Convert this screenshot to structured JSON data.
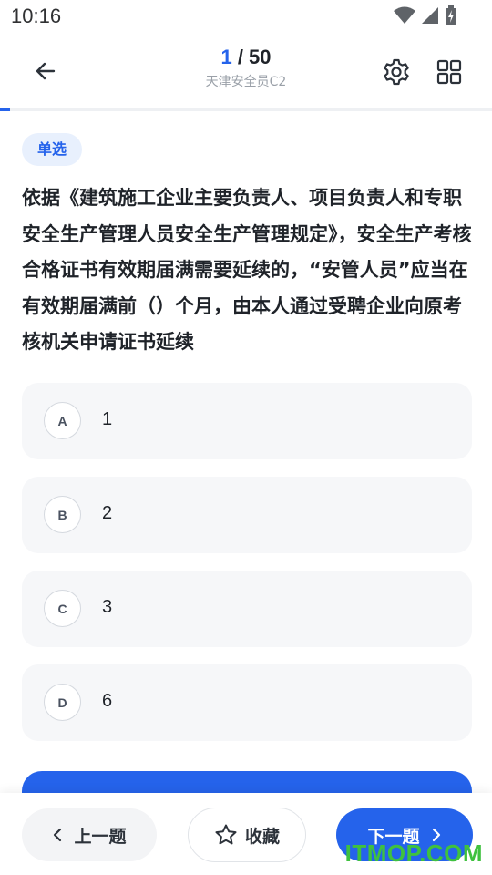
{
  "status_bar": {
    "time": "10:16",
    "icons": [
      "wifi-icon",
      "signal-icon",
      "battery-charging-icon"
    ]
  },
  "header": {
    "current": "1",
    "separator": " / ",
    "total": "50",
    "subtitle": "天津安全员C2",
    "icons": [
      "back-arrow-icon",
      "gear-icon",
      "grid-icon"
    ]
  },
  "progress": {
    "fraction": 0.02
  },
  "question": {
    "type": "单选",
    "text": "依据《建筑施工企业主要负责人、项目负责人和专职安全生产管理人员安全生产管理规定》，安全生产考核合格证书有效期届满需要延续的，“安管人员”应当在有效期届满前（）个月，由本人通过受聘企业向原考核机关申请证书延续",
    "options": [
      {
        "letter": "A",
        "text": "1"
      },
      {
        "letter": "B",
        "text": "2"
      },
      {
        "letter": "C",
        "text": "3"
      },
      {
        "letter": "D",
        "text": "6"
      }
    ]
  },
  "bottom_bar": {
    "prev_label": "上一题",
    "favorite_label": "收藏",
    "next_label": "下一题",
    "icons": [
      "chevron-left-icon",
      "star-icon",
      "chevron-right-icon"
    ]
  },
  "watermark": "ITMOP.COM",
  "colors": {
    "accent": "#2563eb",
    "badge_bg": "#e8f0fd",
    "option_bg": "#f6f7f9",
    "watermark": "#3fc13f"
  }
}
